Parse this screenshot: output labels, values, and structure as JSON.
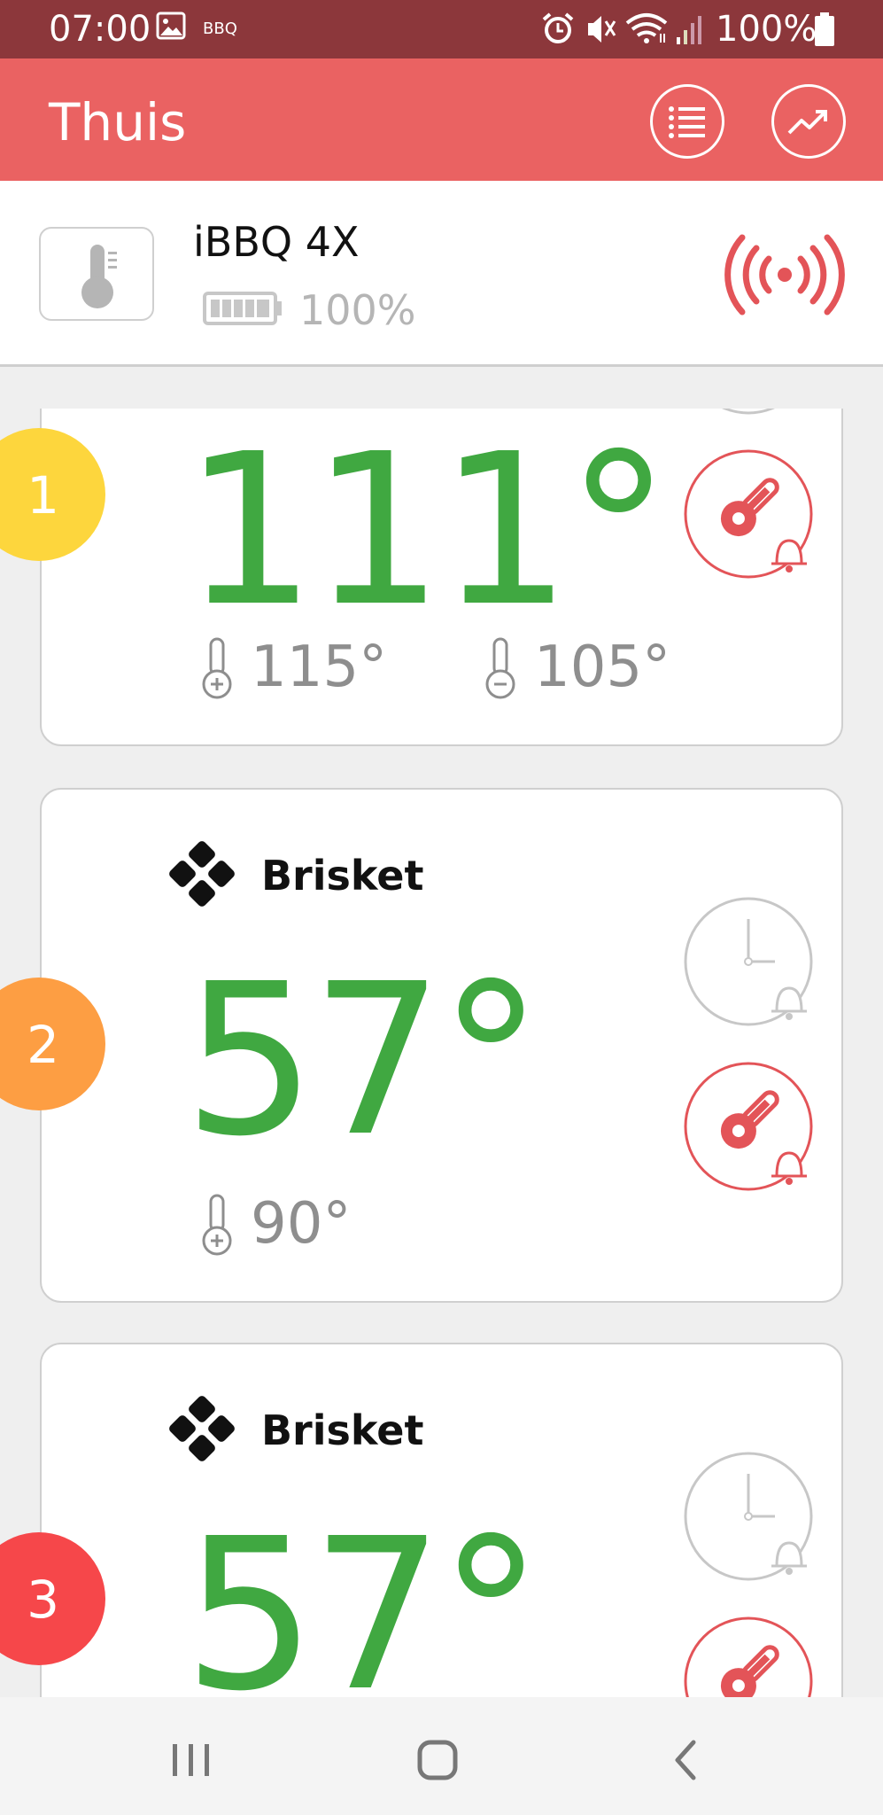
{
  "status_bar": {
    "time": "07:00",
    "notification_label": "BBQ",
    "battery": "100%",
    "icons": [
      "gallery-icon",
      "alarm-icon",
      "mute-icon",
      "wifi-icon",
      "signal-icon",
      "battery-icon"
    ]
  },
  "app_bar": {
    "title": "Thuis",
    "actions": [
      "list-icon",
      "trend-chart-icon"
    ]
  },
  "device": {
    "name": "iBBQ 4X",
    "battery": "100%",
    "connection_icon": "broadcast-signal-icon"
  },
  "probes": [
    {
      "number": "1",
      "name": "",
      "temperature": "111°",
      "upper_limit": "115°",
      "lower_limit": "105°",
      "badge_color": "#fdd63d"
    },
    {
      "number": "2",
      "name": "Brisket",
      "temperature": "57°",
      "upper_limit": "90°",
      "badge_color": "#fd9e43"
    },
    {
      "number": "3",
      "name": "Brisket",
      "temperature": "57°",
      "badge_color": "#f6474a"
    }
  ],
  "colors": {
    "status_bar": "#8c373b",
    "app_bar": "#ea6262",
    "temperature": "#40a841",
    "alarm_red": "#e35458",
    "muted_gray": "#8e8e8e"
  },
  "nav_bar": {
    "buttons": [
      "recent-apps-icon",
      "home-icon",
      "back-icon"
    ]
  }
}
